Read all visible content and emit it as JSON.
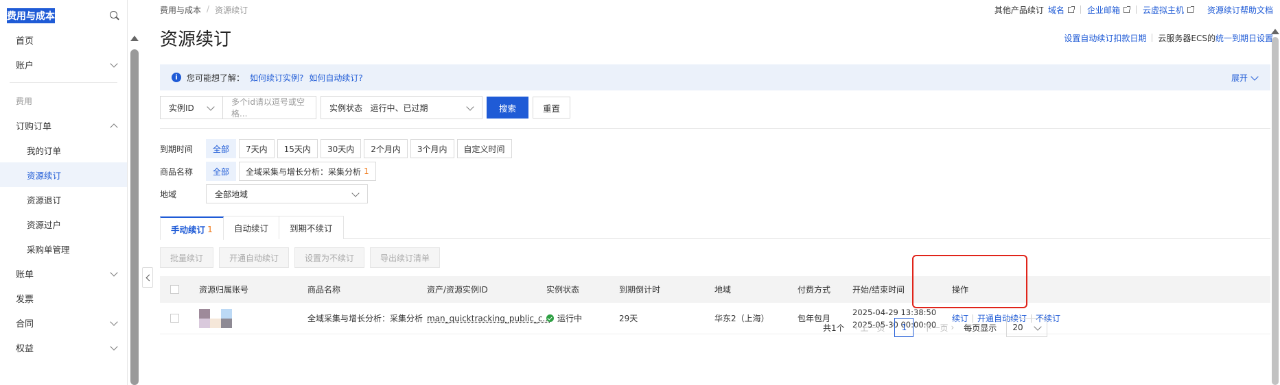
{
  "sidebar": {
    "title": "费用与成本",
    "items": [
      {
        "label": "首页"
      },
      {
        "label": "账户"
      },
      {
        "label": "费用"
      },
      {
        "label": "订购订单"
      },
      {
        "label": "我的订单"
      },
      {
        "label": "资源续订"
      },
      {
        "label": "资源退订"
      },
      {
        "label": "资源过户"
      },
      {
        "label": "采购单管理"
      },
      {
        "label": "账单"
      },
      {
        "label": "发票"
      },
      {
        "label": "合同"
      },
      {
        "label": "权益"
      }
    ]
  },
  "breadcrumb": {
    "root": "费用与成本",
    "sep": "/",
    "current": "资源续订"
  },
  "toplinks": {
    "label": "其他产品续订",
    "links": [
      "域名",
      "企业邮箱",
      "云虚拟主机"
    ],
    "help": "资源续订帮助文档"
  },
  "page": {
    "title": "资源续订",
    "auto_deduct_link": "设置自动续订扣款日期",
    "ecs_text": "云服务器ECS的",
    "ecs_link": "统一到期日设置"
  },
  "notice": {
    "prefix": "您可能想了解：",
    "link1": "如何续订实例?",
    "link2": "如何自动续订?",
    "expand": "展开"
  },
  "search": {
    "field_select": "实例ID",
    "input_placeholder": "多个id请以逗号或空格...",
    "status_label": "实例状态",
    "status_value": "运行中、已过期",
    "search_btn": "搜索",
    "reset_btn": "重置"
  },
  "filters": {
    "expire_label": "到期时间",
    "expire_options": [
      "全部",
      "7天内",
      "15天内",
      "30天内",
      "2个月内",
      "3个月内",
      "自定义时间"
    ],
    "product_label": "商品名称",
    "product_all": "全部",
    "product_option": "全域采集与增长分析：采集分析",
    "product_count": "1",
    "region_label": "地域",
    "region_value": "全部地域"
  },
  "tabs": [
    {
      "label": "手动续订",
      "count": "1"
    },
    {
      "label": "自动续订",
      "count": ""
    },
    {
      "label": "到期不续订",
      "count": ""
    }
  ],
  "batch_actions": [
    "批量续订",
    "开通自动续订",
    "设置为不续订",
    "导出续订清单"
  ],
  "table": {
    "headers": [
      "资源归属账号",
      "商品名称",
      "资产/资源实例ID",
      "实例状态",
      "到期倒计时",
      "地域",
      "付费方式",
      "开始/结束时间",
      "操作"
    ],
    "rows": [
      {
        "product": "全域采集与增长分析：采集分析",
        "instance_id": "man_quicktracking_public_c...",
        "status": "运行中",
        "countdown": "29天",
        "region": "华东2（上海）",
        "billing": "包年包月",
        "start": "2025-04-29 13:38:50",
        "end": "2025-05-30 00:00:00",
        "ops": [
          "续订",
          "开通自动续订",
          "不续订"
        ]
      }
    ]
  },
  "pager": {
    "total": "共1个",
    "prev": "上一页",
    "page": "1",
    "next": "下一页",
    "size_label": "每页显示",
    "size": "20"
  },
  "colors": {
    "accent": "#1f5bd6",
    "highlight": "#e0241a",
    "count": "#f07a1a",
    "status_ok": "#2ea043"
  }
}
